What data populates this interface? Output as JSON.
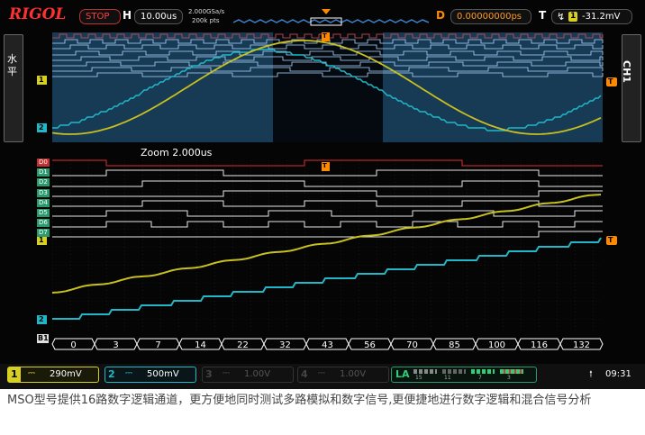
{
  "header": {
    "brand": "RIGOL",
    "run_state": "STOP",
    "h_label": "H",
    "timebase": "10.00us",
    "sample_rate": "2.000GSa/s",
    "memory_depth": "200k pts",
    "delay_label": "D",
    "delay": "0.00000000ps",
    "trigger_label": "T",
    "trigger_channel": "1",
    "trigger_level": "-31.2mV"
  },
  "side": {
    "left_label": "水平",
    "right_label": "CH1"
  },
  "main": {
    "zoom_label": "Zoom  2.000us",
    "marker_t": "T",
    "channel_1": "1",
    "channel_2": "2"
  },
  "digital": {
    "labels": [
      "D0",
      "D1",
      "D2",
      "D3",
      "D4",
      "D5",
      "D6",
      "D7"
    ],
    "bus_label": "B1",
    "bus_values": [
      "0",
      "3",
      "7",
      "14",
      "22",
      "32",
      "43",
      "56",
      "70",
      "85",
      "100",
      "116",
      "132"
    ]
  },
  "footer": {
    "ch1_num": "1",
    "ch1_value": "290mV",
    "ch2_num": "2",
    "ch2_value": "500mV",
    "ch3_num": "3",
    "ch3_value": "1.00V",
    "ch4_num": "4",
    "ch4_value": "1.00V",
    "la_label": "LA",
    "la_group_a": "15",
    "la_group_b": "11",
    "la_group_c": "7",
    "la_group_d": "3",
    "clock": "09:31"
  },
  "caption": "MSO型号提供16路数字逻辑通道，更方便地同时测试多路模拟和数字信号,更便捷地进行数字逻辑和混合信号分析",
  "colors": {
    "ch1": "#d8d020",
    "ch2": "#20b8c8",
    "digital": "#2a9a6e",
    "brand": "#ff3030",
    "trigger_orange": "#ff8a00"
  }
}
